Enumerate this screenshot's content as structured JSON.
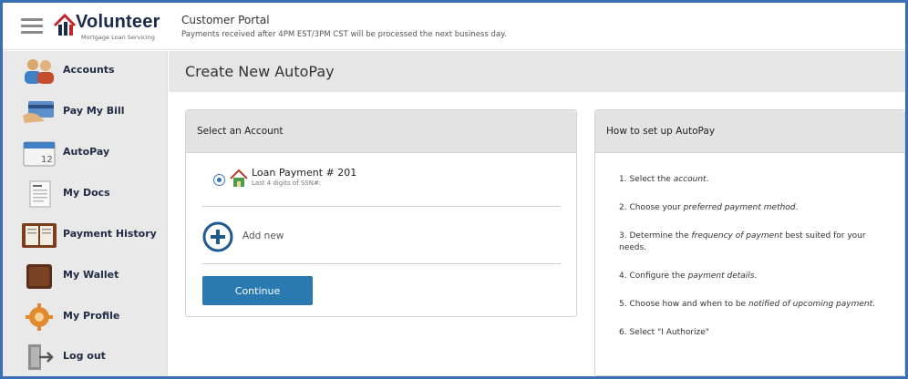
{
  "header": {
    "logo_name": "Volunteer",
    "logo_tagline": "Mortgage Loan Servicing",
    "portal_title": "Customer Portal",
    "portal_note": "Payments received after 4PM EST/3PM CST will be processed the next business day."
  },
  "sidebar": {
    "items": [
      {
        "label": "Accounts",
        "icon": "accounts-icon"
      },
      {
        "label": "Pay My Bill",
        "icon": "pay-bill-icon"
      },
      {
        "label": "AutoPay",
        "icon": "calendar-icon"
      },
      {
        "label": "My Docs",
        "icon": "documents-icon"
      },
      {
        "label": "Payment History",
        "icon": "ledger-icon"
      },
      {
        "label": "My Wallet",
        "icon": "wallet-icon"
      },
      {
        "label": "My Profile",
        "icon": "gear-icon"
      },
      {
        "label": "Log out",
        "icon": "logout-icon"
      }
    ],
    "calendar_day": "12"
  },
  "main": {
    "page_title": "Create New AutoPay",
    "select_account": {
      "heading": "Select an Account",
      "account_label": "Loan Payment # 201",
      "account_sub": "Last 4 digits of SSN#:",
      "add_new_label": "Add new",
      "continue_label": "Continue"
    },
    "howto": {
      "heading": "How to set up AutoPay",
      "steps": [
        {
          "pre": "1. Select the ",
          "em": "account",
          "post": "."
        },
        {
          "pre": "2. Choose your ",
          "em": "preferred payment method",
          "post": "."
        },
        {
          "pre": "3. Determine the ",
          "em": "frequency of payment",
          "post": " best suited for your needs."
        },
        {
          "pre": "4. Configure the ",
          "em": "payment details",
          "post": "."
        },
        {
          "pre": "5. Choose how and when to be ",
          "em": "notified of upcoming payment",
          "post": "."
        },
        {
          "pre": "6. Select \"I Authorize\"",
          "em": "",
          "post": ""
        }
      ]
    }
  },
  "colors": {
    "accent": "#2a79b0",
    "frame": "#3a6fb6",
    "sidebar_bg": "#e9e9e9",
    "header_bar": "#e6e6e6"
  }
}
